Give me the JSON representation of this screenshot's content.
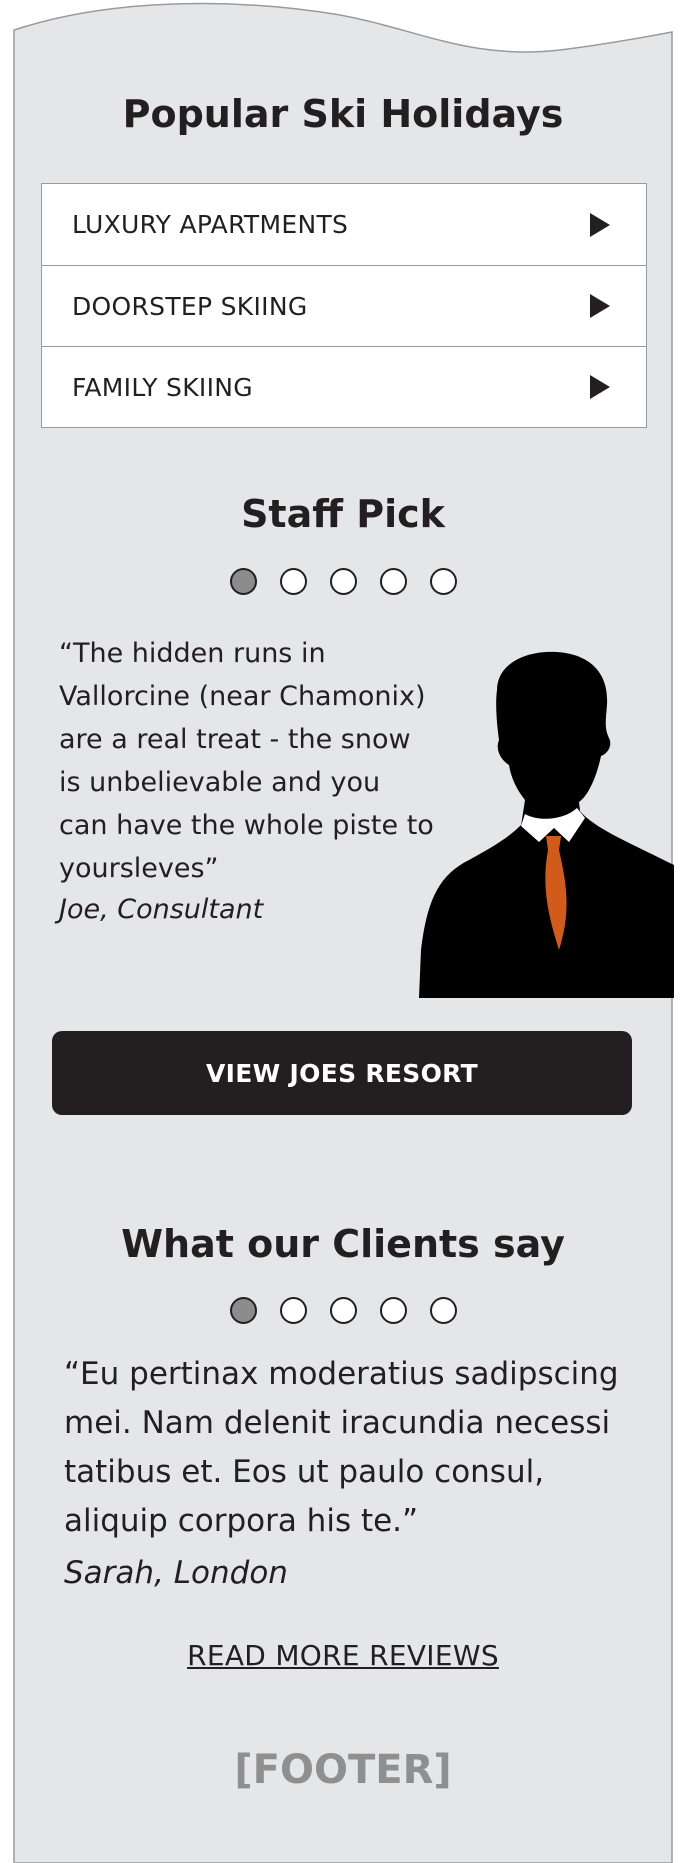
{
  "colors": {
    "panel_bg": "#e5e6e8",
    "panel_border": "#9a9a9a",
    "text_dark": "#231f20",
    "button_bg": "#231f20",
    "dot_active": "#8c8c8c",
    "footer_text": "#8f8f8f",
    "tie_orange": "#d35b1a"
  },
  "popular": {
    "title": "Popular Ski Holidays",
    "items": [
      {
        "label": "LUXURY APARTMENTS",
        "icon": "play-arrow-icon"
      },
      {
        "label": "DOORSTEP SKIING",
        "icon": "play-arrow-icon"
      },
      {
        "label": "FAMILY SKIING",
        "icon": "play-arrow-icon"
      }
    ]
  },
  "staff_pick": {
    "title": "Staff Pick",
    "dots_count": 5,
    "active_dot": 1,
    "quote": "“The hidden runs in Vallorcine (near Chamonix) are a real treat - the snow is unbelievable and you can have the whole piste to yoursleves”",
    "author": "Joe, Consultant",
    "image": "businessman-silhouette",
    "button_label": "VIEW JOES RESORT"
  },
  "clients": {
    "title": "What our Clients say",
    "dots_count": 5,
    "active_dot": 1,
    "quote": "“Eu pertinax moderatius sadipscing mei. Nam delenit iracundia necessi tatibus et. Eos ut paulo consul, aliquip corpora his te.”",
    "author": "Sarah, London",
    "read_more_label": "READ MORE REVIEWS"
  },
  "footer": {
    "label": "[FOOTER]"
  }
}
